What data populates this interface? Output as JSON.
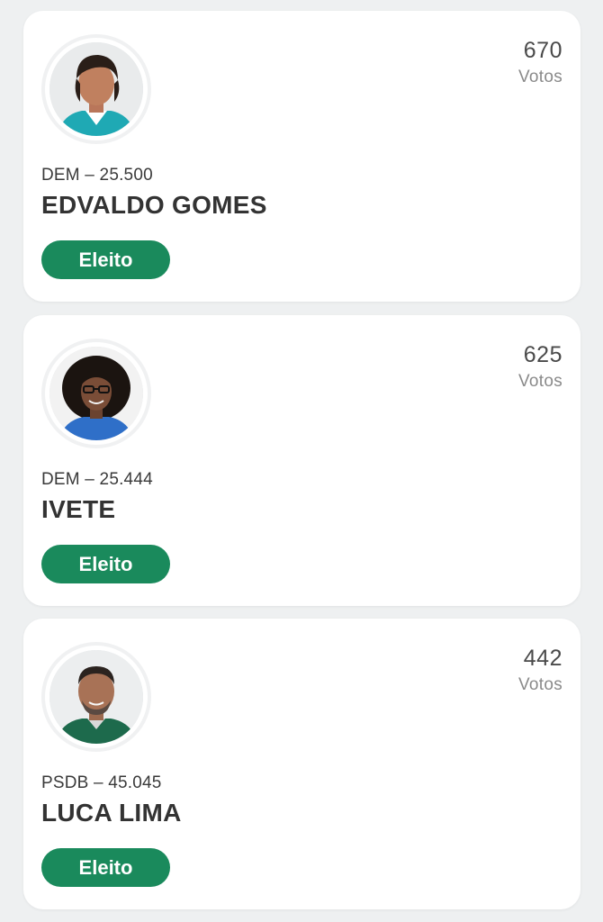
{
  "candidates": [
    {
      "votes": "670",
      "votes_label": "Votos",
      "party": "DEM – 25.500",
      "name": "EDVALDO GOMES",
      "status": "Eleito",
      "shirt_color": "#1fa9b4"
    },
    {
      "votes": "625",
      "votes_label": "Votos",
      "party": "DEM – 25.444",
      "name": "IVETE",
      "status": "Eleito",
      "shirt_color": "#2f6fc8"
    },
    {
      "votes": "442",
      "votes_label": "Votos",
      "party": "PSDB – 45.045",
      "name": "LUCA LIMA",
      "status": "Eleito",
      "shirt_color": "#1d6a4c"
    }
  ],
  "colors": {
    "badge": "#1a8a5c",
    "card": "#ffffff",
    "background": "#eef0f1"
  }
}
